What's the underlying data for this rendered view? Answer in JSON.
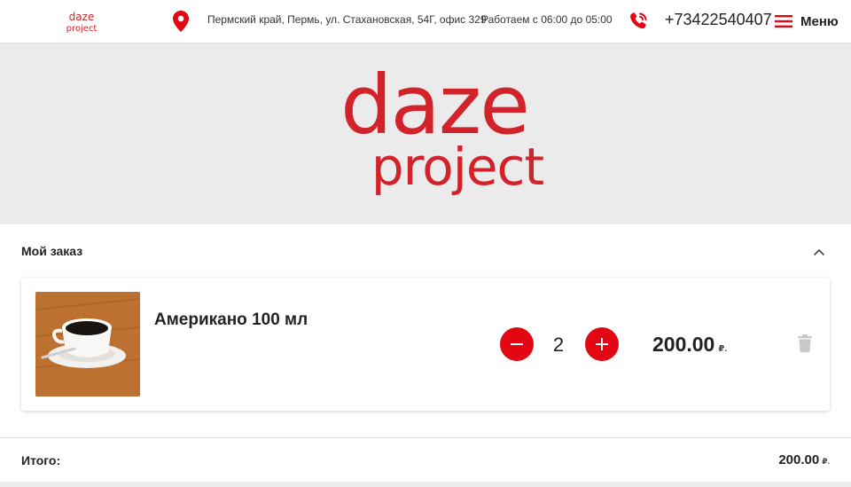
{
  "brand": {
    "logo_line1": "daze",
    "logo_line2": "project",
    "accent": "#e30613",
    "logo_color": "#d2232a"
  },
  "header": {
    "address": "Пермский край, Пермь, ул. Стахановская, 54Г, офис 329",
    "hours": "Работаем с 06:00 до 05:00",
    "phone": "+73422540407",
    "menu_label": "Меню",
    "icons": [
      "location-pin-icon",
      "phone-icon",
      "hamburger-icon"
    ]
  },
  "order": {
    "title": "Мой заказ",
    "items": [
      {
        "name": "Американо 100 мл",
        "quantity": "2",
        "price": "200.00",
        "currency": "₽."
      }
    ],
    "total_label": "Итого:",
    "total_value": "200.00",
    "total_currency": "₽."
  }
}
